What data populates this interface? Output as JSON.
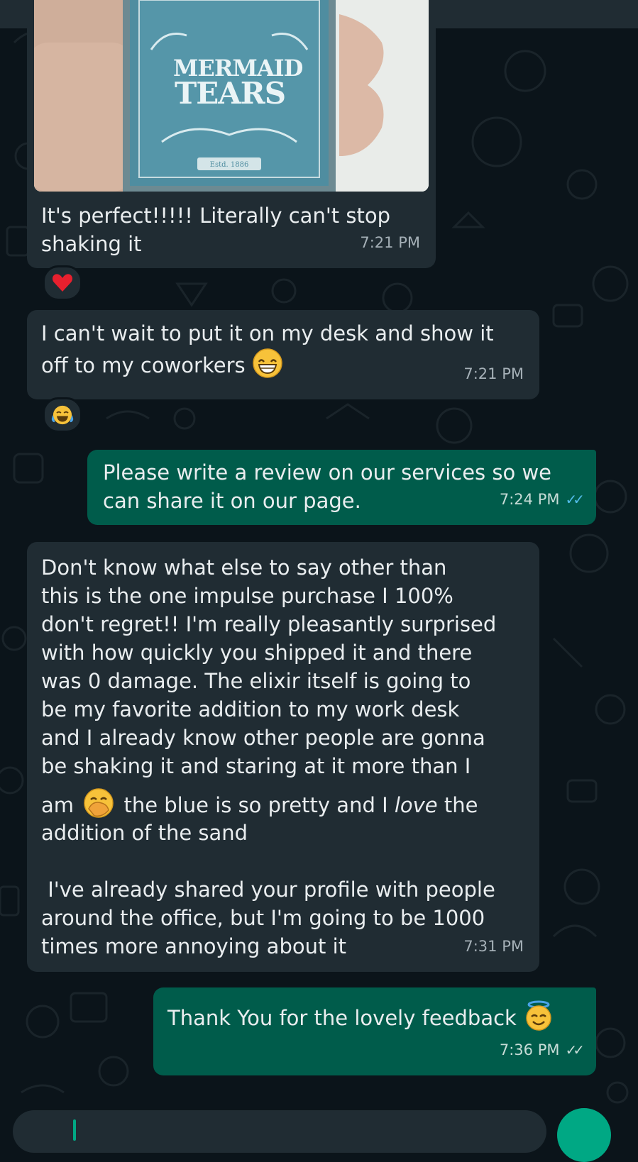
{
  "photo": {
    "label_top": "MERMAID",
    "label_bottom": "TEARS",
    "est": "Estd. 1886"
  },
  "messages": [
    {
      "text": "It's perfect!!!!! Literally can't stop\nshaking it",
      "time": "7:21 PM"
    },
    {
      "text": "I can't wait to put it on my desk and show it\noff to my coworkers",
      "time": "7:21 PM"
    },
    {
      "text": "Please write a review on our services so we\ncan share it on our page.",
      "time": "7:24 PM"
    },
    {
      "text_a": "Don't know what else to say other than\nthis is the one impulse purchase I 100%\ndon't regret!! I'm really pleasantly surprised\nwith how quickly you shipped it and there\nwas 0 damage. The elixir itself is going to\nbe my favorite addition to my work desk\nand I already know other people are gonna\nbe shaking it and staring at it more than I",
      "text_b_pre": "am",
      "text_b_mid": " the blue is so pretty and I ",
      "text_b_em": "love",
      "text_b_post": " the",
      "text_c": "addition of the sand\n\n I've already shared your profile with people\naround the office, but I'm going to be 1000\ntimes more annoying about it",
      "time": "7:31 PM"
    },
    {
      "text": "Thank You for the lovely feedback",
      "time": "7:36 PM"
    }
  ],
  "reactions": {
    "first": "red-heart",
    "second": "tears-of-joy"
  },
  "colors": {
    "background": "#0b141a",
    "incoming": "#202c33",
    "outgoing": "#005c4b",
    "accent": "#00a884",
    "read_ticks": "#53bdeb"
  }
}
